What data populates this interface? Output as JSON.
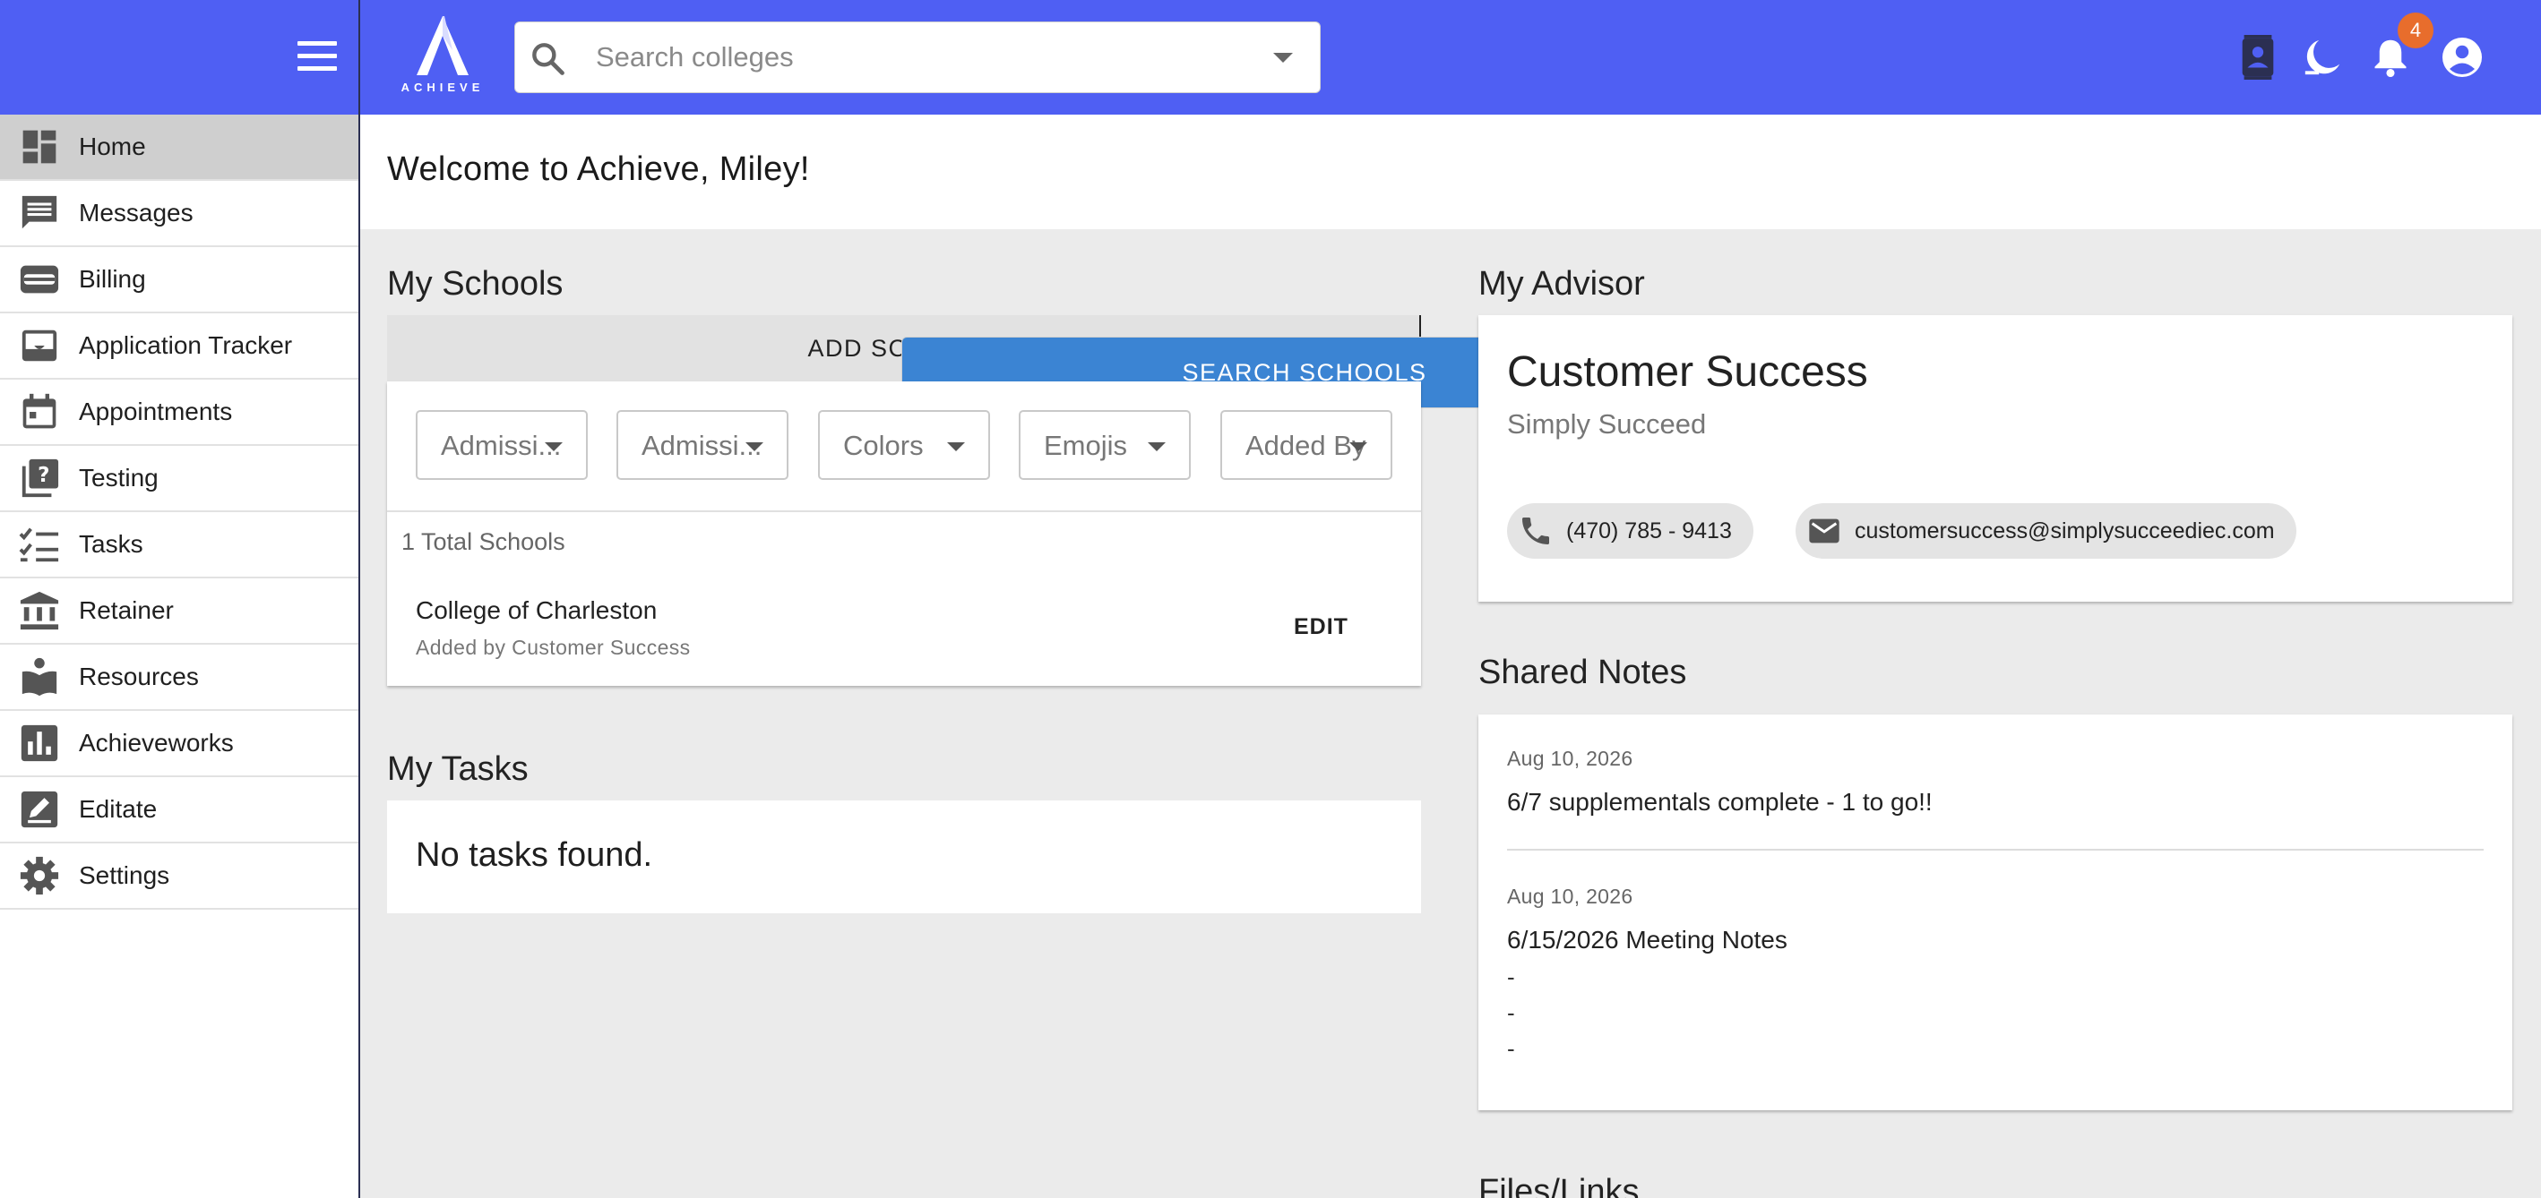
{
  "header": {
    "logo_text": "ACHIEVE",
    "search_placeholder": "Search colleges",
    "notification_count": "4"
  },
  "sidebar": {
    "items": [
      {
        "label": "Home",
        "icon": "dashboard-icon",
        "active": true
      },
      {
        "label": "Messages",
        "icon": "message-icon"
      },
      {
        "label": "Billing",
        "icon": "wallet-icon"
      },
      {
        "label": "Application Tracker",
        "icon": "inbox-icon"
      },
      {
        "label": "Appointments",
        "icon": "calendar-icon"
      },
      {
        "label": "Testing",
        "icon": "quiz-icon"
      },
      {
        "label": "Tasks",
        "icon": "checklist-icon"
      },
      {
        "label": "Retainer",
        "icon": "bank-icon"
      },
      {
        "label": "Resources",
        "icon": "book-icon"
      },
      {
        "label": "Achieveworks",
        "icon": "bar-chart-icon"
      },
      {
        "label": "Editate",
        "icon": "edit-icon"
      },
      {
        "label": "Settings",
        "icon": "gear-icon"
      }
    ]
  },
  "main": {
    "welcome": "Welcome to Achieve, Miley!",
    "my_schools": {
      "title": "My Schools",
      "tab_add": "ADD SCHOOLS",
      "tab_search": "SEARCH SCHOOLS",
      "filters": [
        "Admissi...",
        "Admissi...",
        "Colors",
        "Emojis",
        "Added By"
      ],
      "total": "1 Total Schools",
      "school": {
        "name": "College of Charleston",
        "added_by": "Added by Customer Success",
        "edit_label": "EDIT"
      }
    },
    "my_tasks": {
      "title": "My Tasks",
      "empty": "No tasks found."
    },
    "advisor": {
      "title": "My Advisor",
      "name": "Customer Success",
      "company": "Simply Succeed",
      "phone": "(470) 785 - 9413",
      "email": "customersuccess@simplysucceediec.com"
    },
    "shared_notes": {
      "title": "Shared Notes",
      "notes": [
        {
          "date": "Aug 10, 2026",
          "title": "6/7 supplementals complete - 1 to go!!"
        },
        {
          "date": "Aug 10, 2026",
          "title": "6/15/2026 Meeting Notes",
          "lines": [
            "-",
            "-",
            "-"
          ]
        }
      ]
    },
    "files_title": "Files/Links"
  },
  "colors": {
    "topbar": "#4f5ff3",
    "tab_active": "#3b84d3",
    "badge": "#e86d2c"
  }
}
